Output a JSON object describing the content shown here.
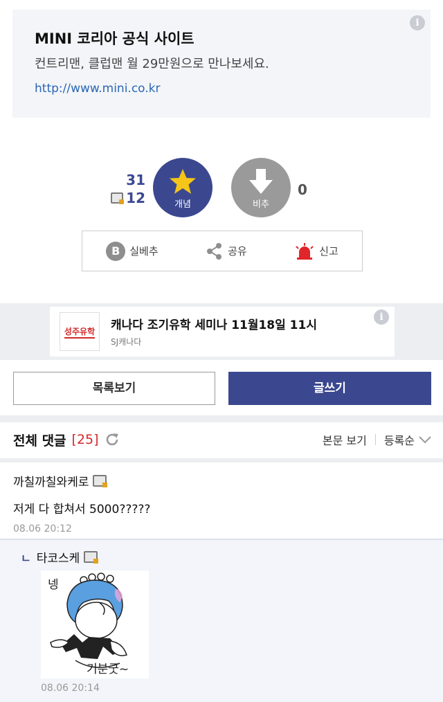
{
  "ad_top": {
    "title": "MINI 코리아 공식 사이트",
    "description": "컨트리맨, 클럽맨 월 29만원으로 만나보세요.",
    "url": "http://www.mini.co.kr",
    "info_icon": "info-icon"
  },
  "vote": {
    "up_count": "31",
    "fix_count": "12",
    "up_label": "개념",
    "down_label": "비추",
    "down_count": "0",
    "accent": "#3b4890"
  },
  "actions": {
    "best": "실베추",
    "share": "공유",
    "report": "신고"
  },
  "ad_mid": {
    "logo_text": "성주유학",
    "title": "캐나다 조기유학 세미나 11월18일 11시",
    "subtitle": "SJ캐나다"
  },
  "buttons": {
    "list": "목록보기",
    "write": "글쓰기"
  },
  "comments_header": {
    "title": "전체 댓글",
    "count": "[25]",
    "view_body": "본문 보기",
    "sort": "등록순"
  },
  "comments": [
    {
      "author": "까칠까칠와케로",
      "text": "저게 다 합쳐서 5000?????",
      "date": "08.06 20:12"
    }
  ],
  "reply": {
    "author": "타코스케",
    "sticker_text_top": "넹",
    "sticker_text_bottom": "기분굿~",
    "date": "08.06 20:14"
  }
}
